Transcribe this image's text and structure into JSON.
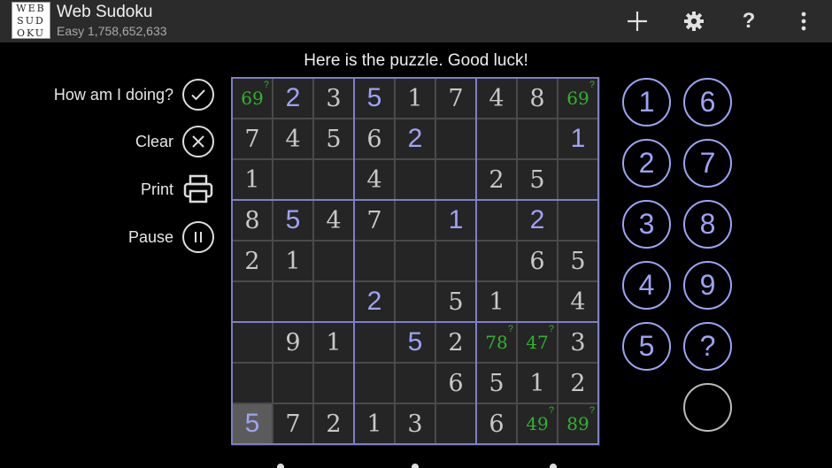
{
  "app": {
    "title": "Web Sudoku",
    "subtitle": "Easy 1,758,652,633",
    "logo_rows": [
      "WEB",
      "SUD",
      "OKU"
    ]
  },
  "toolbar": {
    "icons": [
      "plus-icon",
      "gear-icon",
      "help-icon",
      "more-vert-icon"
    ],
    "help_glyph": "?"
  },
  "message": "Here is the puzzle. Good luck!",
  "controls": [
    {
      "label": "How am I doing?",
      "icon": "check-icon"
    },
    {
      "label": "Clear",
      "icon": "x-icon"
    },
    {
      "label": "Print",
      "icon": "printer-icon"
    },
    {
      "label": "Pause",
      "icon": "pause-icon"
    }
  ],
  "grid": {
    "rows": [
      [
        {
          "v": "69",
          "t": "guess"
        },
        {
          "v": "2",
          "t": "entered"
        },
        {
          "v": "3",
          "t": "given"
        },
        {
          "v": "5",
          "t": "entered"
        },
        {
          "v": "1",
          "t": "given"
        },
        {
          "v": "7",
          "t": "given"
        },
        {
          "v": "4",
          "t": "given"
        },
        {
          "v": "8",
          "t": "given"
        },
        {
          "v": "69",
          "t": "guess"
        }
      ],
      [
        {
          "v": "7",
          "t": "given"
        },
        {
          "v": "4",
          "t": "given"
        },
        {
          "v": "5",
          "t": "given"
        },
        {
          "v": "6",
          "t": "given"
        },
        {
          "v": "2",
          "t": "entered"
        },
        {
          "v": "",
          "t": "empty"
        },
        {
          "v": "",
          "t": "empty"
        },
        {
          "v": "",
          "t": "empty"
        },
        {
          "v": "1",
          "t": "entered"
        }
      ],
      [
        {
          "v": "1",
          "t": "given"
        },
        {
          "v": "",
          "t": "empty"
        },
        {
          "v": "",
          "t": "empty"
        },
        {
          "v": "4",
          "t": "given"
        },
        {
          "v": "",
          "t": "empty"
        },
        {
          "v": "",
          "t": "empty"
        },
        {
          "v": "2",
          "t": "given"
        },
        {
          "v": "5",
          "t": "given"
        },
        {
          "v": "",
          "t": "empty"
        }
      ],
      [
        {
          "v": "8",
          "t": "given"
        },
        {
          "v": "5",
          "t": "entered"
        },
        {
          "v": "4",
          "t": "given"
        },
        {
          "v": "7",
          "t": "given"
        },
        {
          "v": "",
          "t": "empty"
        },
        {
          "v": "1",
          "t": "entered"
        },
        {
          "v": "",
          "t": "empty"
        },
        {
          "v": "2",
          "t": "entered"
        },
        {
          "v": "",
          "t": "empty"
        }
      ],
      [
        {
          "v": "2",
          "t": "given"
        },
        {
          "v": "1",
          "t": "given"
        },
        {
          "v": "",
          "t": "empty"
        },
        {
          "v": "",
          "t": "empty"
        },
        {
          "v": "",
          "t": "empty"
        },
        {
          "v": "",
          "t": "empty"
        },
        {
          "v": "",
          "t": "empty"
        },
        {
          "v": "6",
          "t": "given"
        },
        {
          "v": "5",
          "t": "given"
        }
      ],
      [
        {
          "v": "",
          "t": "empty"
        },
        {
          "v": "",
          "t": "empty"
        },
        {
          "v": "",
          "t": "empty"
        },
        {
          "v": "2",
          "t": "entered"
        },
        {
          "v": "",
          "t": "empty"
        },
        {
          "v": "5",
          "t": "given"
        },
        {
          "v": "1",
          "t": "given"
        },
        {
          "v": "",
          "t": "empty"
        },
        {
          "v": "4",
          "t": "given"
        }
      ],
      [
        {
          "v": "",
          "t": "empty"
        },
        {
          "v": "9",
          "t": "given"
        },
        {
          "v": "1",
          "t": "given"
        },
        {
          "v": "",
          "t": "empty"
        },
        {
          "v": "5",
          "t": "entered"
        },
        {
          "v": "2",
          "t": "given"
        },
        {
          "v": "78",
          "t": "guess"
        },
        {
          "v": "47",
          "t": "guess"
        },
        {
          "v": "3",
          "t": "given"
        }
      ],
      [
        {
          "v": "",
          "t": "empty"
        },
        {
          "v": "",
          "t": "empty"
        },
        {
          "v": "",
          "t": "empty"
        },
        {
          "v": "",
          "t": "empty"
        },
        {
          "v": "",
          "t": "empty"
        },
        {
          "v": "6",
          "t": "given"
        },
        {
          "v": "5",
          "t": "given"
        },
        {
          "v": "1",
          "t": "given"
        },
        {
          "v": "2",
          "t": "given"
        }
      ],
      [
        {
          "v": "5",
          "t": "entered",
          "selected": true
        },
        {
          "v": "7",
          "t": "given"
        },
        {
          "v": "2",
          "t": "given"
        },
        {
          "v": "1",
          "t": "given"
        },
        {
          "v": "3",
          "t": "given"
        },
        {
          "v": "",
          "t": "empty"
        },
        {
          "v": "6",
          "t": "given"
        },
        {
          "v": "49",
          "t": "guess"
        },
        {
          "v": "89",
          "t": "guess"
        }
      ]
    ],
    "guess_marker": "?"
  },
  "keypad": {
    "keys": [
      "1",
      "6",
      "2",
      "7",
      "3",
      "8",
      "4",
      "9",
      "5",
      "?",
      ""
    ]
  },
  "colors": {
    "accent": "#9da3f5",
    "guess": "#2fb32f",
    "box_border": "#7c80c4",
    "cell_bg": "#252525",
    "selected": "#5b5b5b"
  }
}
